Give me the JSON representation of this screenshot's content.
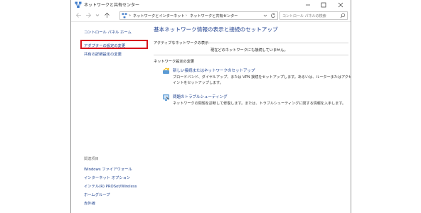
{
  "window": {
    "title": "ネットワークと共有センター"
  },
  "navbar": {
    "breadcrumb": [
      "ネットワークとインターネット",
      "ネットワークと共有センター"
    ],
    "search_placeholder": "コントロール パネルの検索"
  },
  "sidebar": {
    "home_link": "コントロール パネル ホーム",
    "items": [
      {
        "label": "アダプターの設定の変更"
      },
      {
        "label": "共有の詳細設定の変更"
      }
    ],
    "related_heading": "関連項目",
    "related": [
      {
        "label": "Windows ファイアウォール"
      },
      {
        "label": "インターネット オプション"
      },
      {
        "label": "インテル(R) PROSet/Wireless"
      },
      {
        "label": "ホームグループ"
      },
      {
        "label": "赤外線"
      }
    ]
  },
  "main": {
    "title": "基本ネットワーク情報の表示と接続のセットアップ",
    "active_section": "アクティブなネットワークの表示",
    "active_status": "現在どのネットワークにも接続していません。",
    "change_section": "ネットワーク設定の変更",
    "tasks": [
      {
        "link": "新しい接続またはネットワークのセットアップ",
        "desc": [
          "ブロードバンド、ダイヤルアップ、または VPN 接続をセットアップします。あるいは、ルーターまたはアクセス ポ",
          "イントをセットアップします。"
        ]
      },
      {
        "link": "問題のトラブルシューティング",
        "desc": [
          "ネットワークの問題を診断して修復します。または、トラブルシューティングに関する情報を入手します。"
        ]
      }
    ]
  },
  "colors": {
    "link": "#1a3e8c",
    "title": "#1e3f8f",
    "highlight": "#d8141d"
  }
}
